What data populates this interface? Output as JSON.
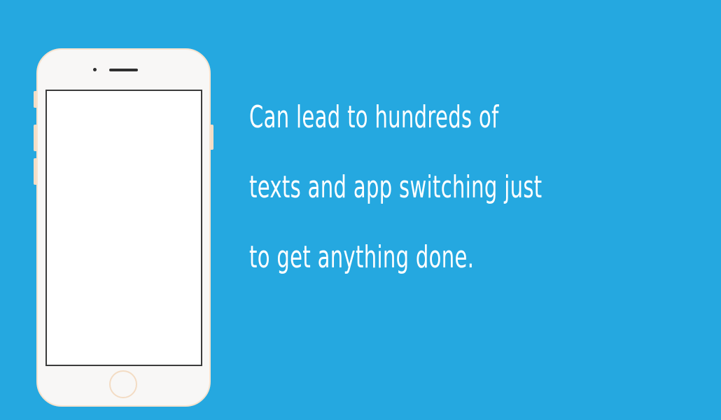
{
  "slide": {
    "background_color": "#25a8e0",
    "message_lines": [
      "Can lead to hundreds of",
      "texts and app switching just",
      "to get anything done."
    ]
  },
  "phone": {
    "device": "smartphone",
    "body_color": "#f8f7f6",
    "trim_color": "#f6e3cf",
    "screen_color": "#ffffff"
  }
}
